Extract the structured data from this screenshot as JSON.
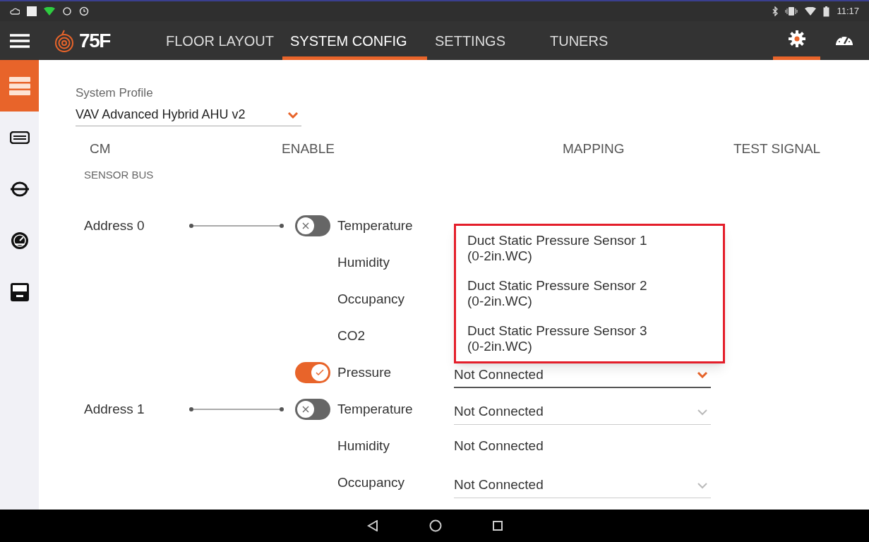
{
  "status_bar": {
    "time": "11:17"
  },
  "nav": {
    "logo": "75F",
    "tabs": [
      {
        "label": "FLOOR LAYOUT",
        "selected": false
      },
      {
        "label": "SYSTEM CONFIG",
        "selected": true
      },
      {
        "label": "SETTINGS",
        "selected": false
      },
      {
        "label": "TUNERS",
        "selected": false
      }
    ],
    "icons": [
      {
        "kind": "settings",
        "selected": true
      },
      {
        "kind": "dashboard",
        "selected": false
      }
    ]
  },
  "sidebar": {
    "items": [
      {
        "kind": "rack",
        "selected": true
      },
      {
        "kind": "unit",
        "selected": false
      },
      {
        "kind": "pipe",
        "selected": false
      },
      {
        "kind": "gauge",
        "selected": false
      },
      {
        "kind": "meter",
        "selected": false
      }
    ]
  },
  "profile": {
    "label": "System Profile",
    "value": "VAV Advanced Hybrid AHU v2"
  },
  "columns": [
    "CM",
    "ENABLE",
    "MAPPING",
    "TEST SIGNAL"
  ],
  "section": "SENSOR BUS",
  "addresses": [
    {
      "label": "Address 0",
      "sensors": [
        {
          "name": "Temperature",
          "toggle": {
            "on": false
          }
        },
        {
          "name": "Humidity"
        },
        {
          "name": "Occupancy"
        },
        {
          "name": "CO2"
        },
        {
          "name": "Pressure",
          "toggle": {
            "on": true
          },
          "mapping": {
            "value": "Not Connected",
            "kind": "dropdown",
            "focused": true
          }
        }
      ]
    },
    {
      "label": "Address 1",
      "sensors": [
        {
          "name": "Temperature",
          "toggle": {
            "on": false
          },
          "mapping": {
            "value": "Not Connected",
            "kind": "dropdown",
            "focused": false
          }
        },
        {
          "name": "Humidity",
          "mapping": {
            "value": "Not Connected",
            "kind": "plain"
          }
        },
        {
          "name": "Occupancy",
          "mapping": {
            "value": "Not Connected",
            "kind": "dropdown",
            "focused": false
          }
        }
      ]
    }
  ],
  "popup": {
    "options": [
      {
        "name": "Duct Static Pressure Sensor 1",
        "range": "(0-2in.WC)"
      },
      {
        "name": "Duct Static Pressure Sensor 2",
        "range": "(0-2in.WC)"
      },
      {
        "name": "Duct Static Pressure Sensor 3",
        "range": "(0-2in.WC)"
      }
    ]
  }
}
